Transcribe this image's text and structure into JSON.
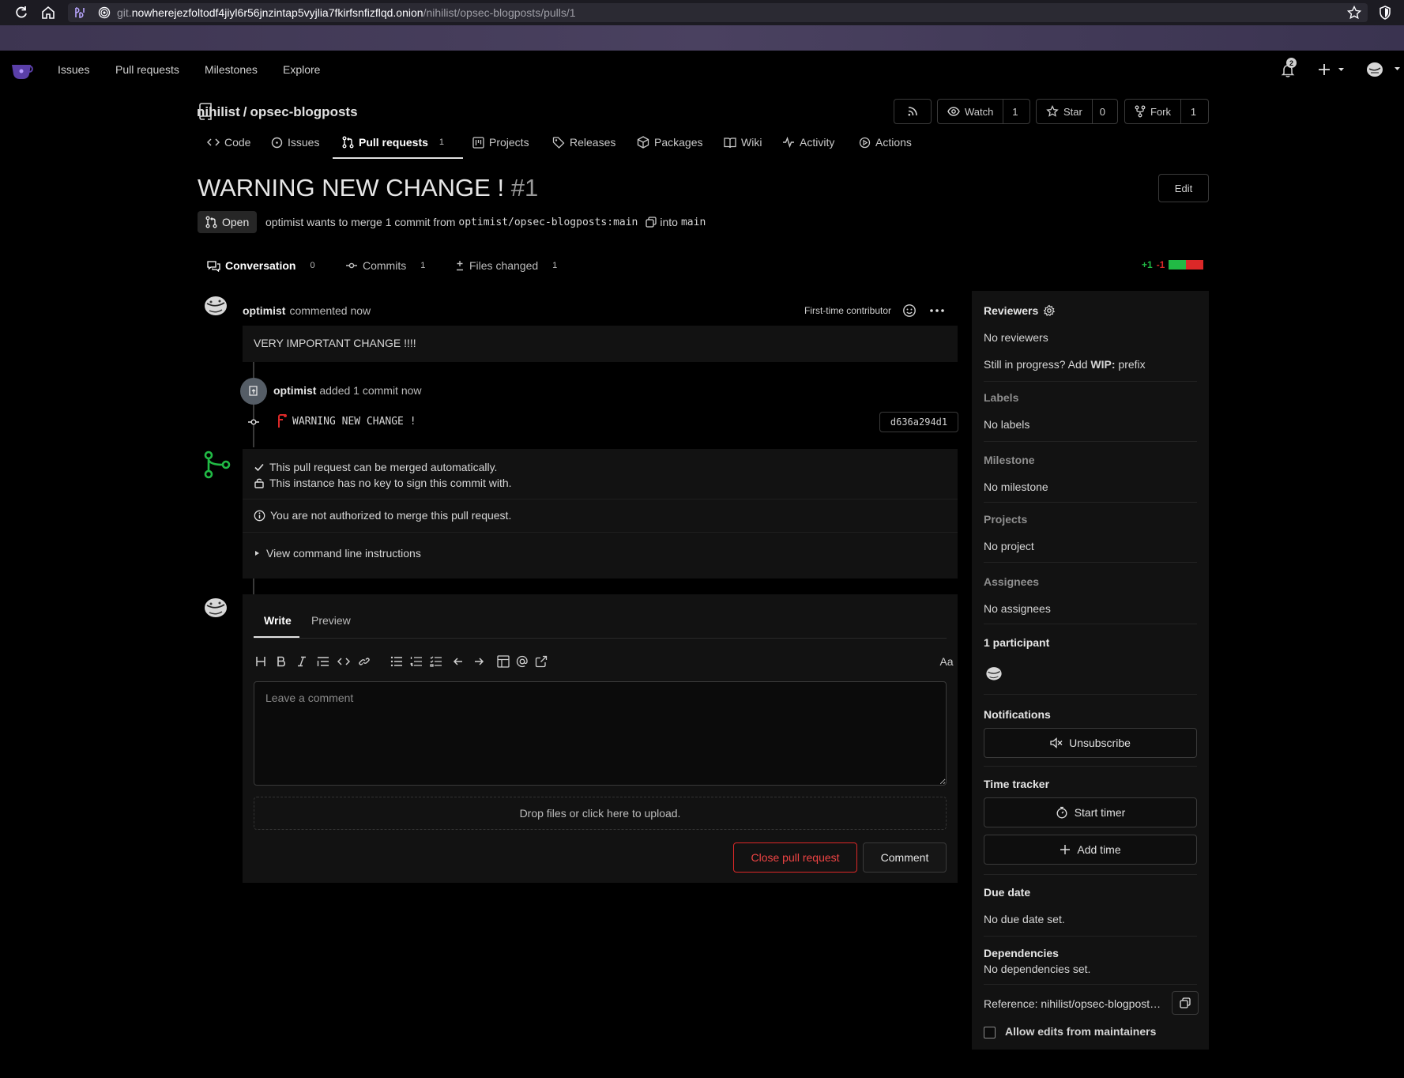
{
  "browser": {
    "url_prefix": "git.",
    "url_host": "nowherejezfoltodf4jiyl6r56jnzintap5vyjlia7fkirfsnfizflqd.onion",
    "url_path": "/nihilist/opsec-blogposts/pulls/1"
  },
  "nav": {
    "items": [
      "Issues",
      "Pull requests",
      "Milestones",
      "Explore"
    ],
    "notification_count": "2"
  },
  "repo": {
    "owner": "nihilist",
    "separator": "/",
    "name": "opsec-blogposts",
    "watch_label": "Watch",
    "watch_count": "1",
    "star_label": "Star",
    "star_count": "0",
    "fork_label": "Fork",
    "fork_count": "1"
  },
  "repo_tabs": {
    "code": "Code",
    "issues": "Issues",
    "pulls": "Pull requests",
    "pulls_count": "1",
    "projects": "Projects",
    "releases": "Releases",
    "packages": "Packages",
    "wiki": "Wiki",
    "activity": "Activity",
    "actions": "Actions"
  },
  "pr": {
    "title": "WARNING NEW CHANGE !",
    "number": "#1",
    "edit_label": "Edit",
    "state": "Open",
    "merge_text_a": "optimist wants to merge 1 commit from",
    "source_branch": "optimist/opsec-blogposts:main",
    "merge_text_b": "into",
    "target_branch": "main"
  },
  "pr_tabs": {
    "conversation": "Conversation",
    "conversation_count": "0",
    "commits": "Commits",
    "commits_count": "1",
    "files": "Files changed",
    "files_count": "1",
    "additions": "+1",
    "deletions": "-1",
    "add_fraction": 0.5
  },
  "comment": {
    "author": "optimist",
    "action": "commented now",
    "badge": "First-time contributor",
    "body": "VERY IMPORTANT CHANGE !!!!"
  },
  "push": {
    "author": "optimist",
    "action": "added 1 commit now",
    "commit_message": "WARNING NEW CHANGE !",
    "commit_sha": "d636a294d1"
  },
  "merge": {
    "line1": "This pull request can be merged automatically.",
    "line2": "This instance has no key to sign this commit with.",
    "line3": "You are not authorized to merge this pull request.",
    "cli": "View command line instructions"
  },
  "form": {
    "write": "Write",
    "preview": "Preview",
    "font_toggle": "Aa",
    "placeholder": "Leave a comment",
    "dropzone": "Drop files or click here to upload.",
    "close_pr": "Close pull request",
    "comment": "Comment"
  },
  "sidebar": {
    "reviewers": "Reviewers",
    "no_reviewers": "No reviewers",
    "wip_prefix_text": "Still in progress? Add",
    "wip_bold": "WIP:",
    "wip_suffix": "prefix",
    "labels": "Labels",
    "no_labels": "No labels",
    "milestone": "Milestone",
    "no_milestone": "No milestone",
    "projects": "Projects",
    "no_project": "No project",
    "assignees": "Assignees",
    "no_assignees": "No assignees",
    "participants": "1 participant",
    "notifications": "Notifications",
    "unsubscribe": "Unsubscribe",
    "time_tracker": "Time tracker",
    "start_timer": "Start timer",
    "add_time": "Add time",
    "due_date": "Due date",
    "no_due_date": "No due date set.",
    "dependencies": "Dependencies",
    "no_dependencies": "No dependencies set.",
    "reference": "Reference: nihilist/opsec-blogpost…",
    "allow_edits": "Allow edits from maintainers"
  },
  "colors": {
    "accent_green": "#21ba45",
    "accent_red": "#db2828",
    "background": "#000000",
    "panel": "#121212"
  }
}
